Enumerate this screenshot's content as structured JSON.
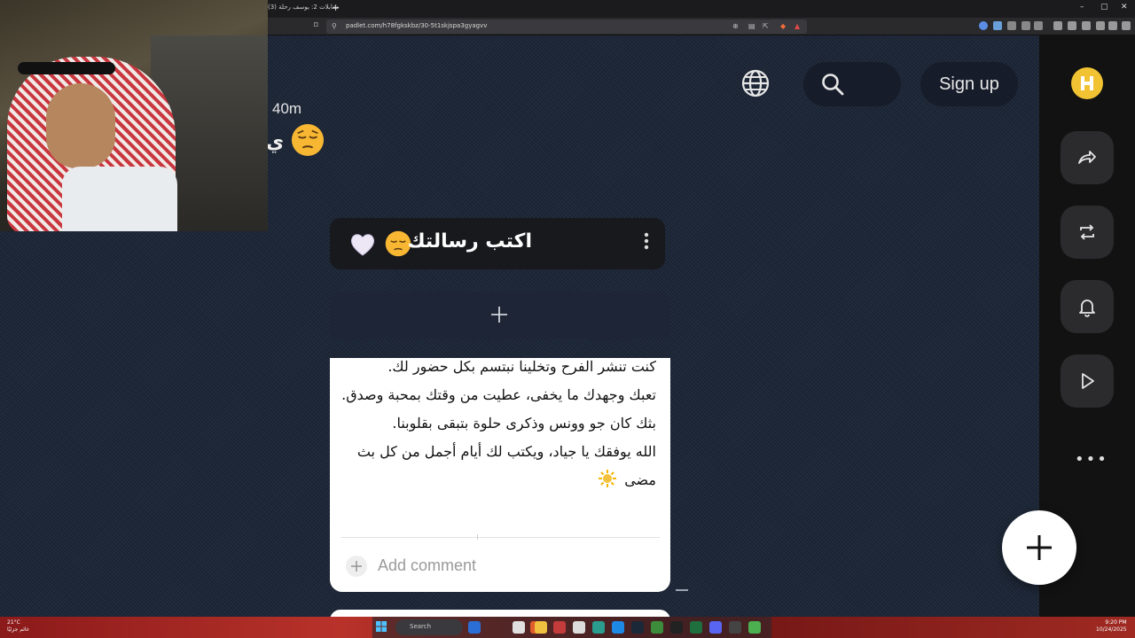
{
  "browser": {
    "tab_title": "(3) مقابلات 2: يوسف رحلة",
    "new_tab_label": "+",
    "url": "padlet.com/h78fgkskbz/30-5t1skjspa3gyagvv",
    "window_controls": [
      "–",
      "▢",
      "✕"
    ]
  },
  "header": {
    "signup_label": "Sign up",
    "search_icon": "search-icon",
    "globe_icon": "globe-icon"
  },
  "post_meta": {
    "time_ago": "40m",
    "partial_title": "ي"
  },
  "column": {
    "title": "اكتب رسالتك",
    "add_icon": "plus-icon",
    "menu_icon": "kebab-menu-icon"
  },
  "post": {
    "lines": [
      "كنت تنشر الفرح وتخلينا نبتسم بكل حضور لك.",
      "تعبك وجهدك ما يخفى، عطيت من وقتك بمحبة وصدق.",
      "بثك كان جو وونس وذكرى حلوة بتبقى بقلوبنا.",
      "الله يوفقك يا جياد، ويكتب لك أيام أجمل من كل بث مضى"
    ],
    "comment_placeholder": "Add comment"
  },
  "rail": {
    "buttons": [
      "share-icon",
      "remake-icon",
      "bell-icon",
      "play-icon"
    ],
    "more_label": "•••"
  },
  "taskbar": {
    "weather_temp": "21°C",
    "weather_desc": "غائم جزئيًا",
    "search_label": "Search",
    "time": "9:20 PM",
    "date": "10/24/2025"
  },
  "colors": {
    "board_bg": "#1d2738",
    "rail_bg": "#121212",
    "avatar": "#f1c232"
  }
}
